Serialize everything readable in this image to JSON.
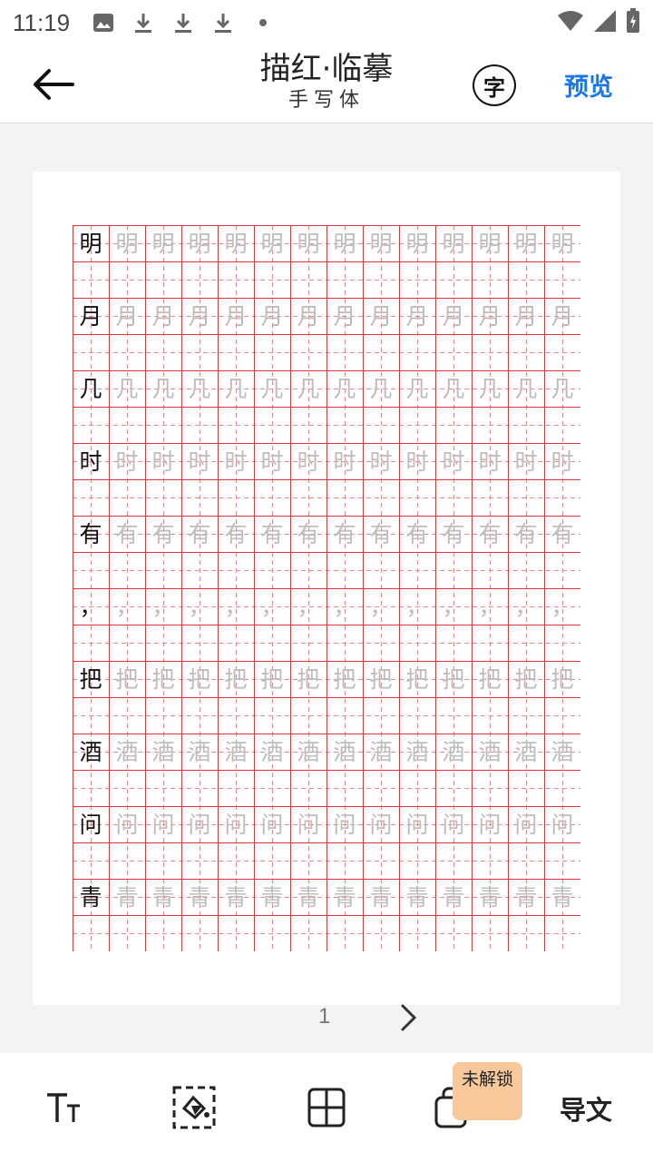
{
  "status_bar": {
    "time": "11:19",
    "icons": [
      "image-icon",
      "download-icon",
      "download-icon",
      "download-icon",
      "dot-icon"
    ],
    "right_icons": [
      "wifi-icon",
      "signal-icon",
      "battery-charging-icon"
    ]
  },
  "header": {
    "title": "描红·临摹",
    "subtitle": "手写体",
    "font_button": "字",
    "preview": "预览",
    "accent_color": "#1677e8"
  },
  "sheet": {
    "grid_color": "#d9363e",
    "guide_color": "#e88a8a",
    "rows": [
      {
        "model": "明",
        "traces": [
          "明",
          "明",
          "明",
          "明",
          "明",
          "明",
          "明",
          "明",
          "明",
          "明",
          "明",
          "明",
          "明"
        ]
      },
      {
        "model": "月",
        "traces": [
          "月",
          "月",
          "月",
          "月",
          "月",
          "月",
          "月",
          "月",
          "月",
          "月",
          "月",
          "月",
          "月"
        ]
      },
      {
        "model": "几",
        "traces": [
          "几",
          "几",
          "几",
          "几",
          "几",
          "几",
          "几",
          "几",
          "几",
          "几",
          "几",
          "几",
          "几"
        ]
      },
      {
        "model": "时",
        "traces": [
          "时",
          "时",
          "时",
          "时",
          "时",
          "时",
          "时",
          "时",
          "时",
          "时",
          "时",
          "时",
          "时"
        ]
      },
      {
        "model": "有",
        "traces": [
          "有",
          "有",
          "有",
          "有",
          "有",
          "有",
          "有",
          "有",
          "有",
          "有",
          "有",
          "有",
          "有"
        ]
      },
      {
        "model": "，",
        "traces": [
          "，",
          "，",
          "，",
          "，",
          "，",
          "，",
          "，",
          "，",
          "，",
          "，",
          "，",
          "，",
          "，"
        ]
      },
      {
        "model": "把",
        "traces": [
          "把",
          "把",
          "把",
          "把",
          "把",
          "把",
          "把",
          "把",
          "把",
          "把",
          "把",
          "把",
          "把"
        ]
      },
      {
        "model": "酒",
        "traces": [
          "酒",
          "酒",
          "酒",
          "酒",
          "酒",
          "酒",
          "酒",
          "酒",
          "酒",
          "酒",
          "酒",
          "酒",
          "酒"
        ]
      },
      {
        "model": "问",
        "traces": [
          "问",
          "问",
          "问",
          "问",
          "问",
          "问",
          "问",
          "问",
          "问",
          "问",
          "问",
          "问",
          "问"
        ]
      },
      {
        "model": "青",
        "traces": [
          "青",
          "青",
          "青",
          "青",
          "青",
          "青",
          "青",
          "青",
          "青",
          "青",
          "青",
          "青",
          "青"
        ]
      }
    ]
  },
  "pager": {
    "page": "1"
  },
  "toolbar": {
    "tools": [
      "font-size-icon",
      "fill-color-icon",
      "grid-style-icon",
      "layers-icon"
    ],
    "lock_badge": "未解锁",
    "export": "导文",
    "lock_color": "#f8c89b"
  }
}
